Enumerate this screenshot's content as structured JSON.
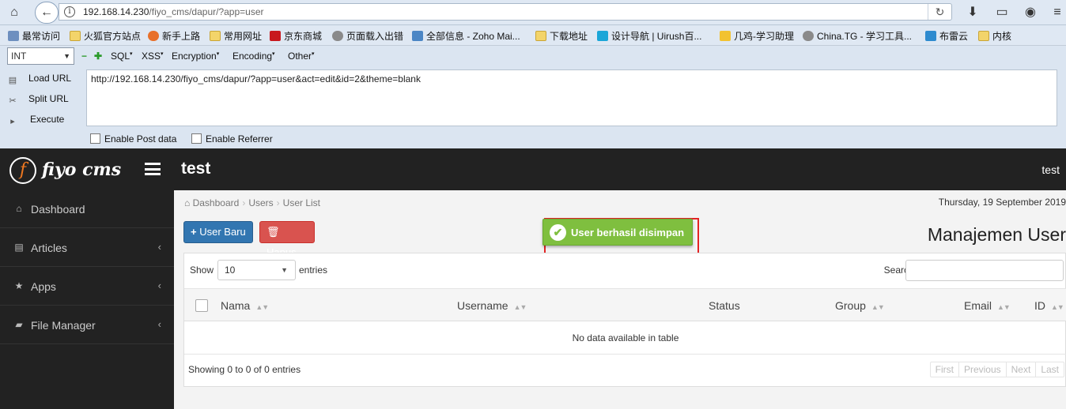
{
  "browser": {
    "url_host": "192.168.14.230",
    "url_path": "/fiyo_cms/dapur/?app=user",
    "bookmarks": [
      "最常访问",
      "火狐官方站点",
      "新手上路",
      "常用网址",
      "京东商城",
      "页面载入出错",
      "全部信息 - Zoho Mai...",
      "下载地址",
      "设计导航 | Uirush百...",
      "几鸡-学习助理",
      "China.TG - 学习工具...",
      "布雷云",
      "内核"
    ]
  },
  "hackbar": {
    "type_value": "INT",
    "menus": [
      "SQL",
      "XSS",
      "Encryption",
      "Encoding",
      "Other"
    ],
    "load_url": "Load URL",
    "split_url": "Split URL",
    "execute": "Execute",
    "url_text": "http://192.168.14.230/fiyo_cms/dapur/?app=user&act=edit&id=2&theme=blank",
    "enable_post": "Enable Post data",
    "enable_referrer": "Enable Referrer"
  },
  "header": {
    "brand": "fiyo cms",
    "logo_letter": "f",
    "site_title": "test",
    "user": "test"
  },
  "sidebar": {
    "items": [
      {
        "label": "Dashboard",
        "icon": "home-icon",
        "chevron": ""
      },
      {
        "label": "Articles",
        "icon": "file-icon",
        "chevron": "‹"
      },
      {
        "label": "Apps",
        "icon": "star-icon",
        "chevron": "‹"
      },
      {
        "label": "File Manager",
        "icon": "folder-open-icon",
        "chevron": "‹"
      }
    ]
  },
  "main": {
    "breadcrumb": [
      "Dashboard",
      "Users",
      "User List"
    ],
    "date": "Thursday, 19 September 2019",
    "new_user_label": "User Baru",
    "delete_label": "Hapus",
    "alert_message": "User berhasil disimpan",
    "page_title": "Manajemen User",
    "table": {
      "show_label": "Show",
      "page_length": "10",
      "entries_label": "entries",
      "search_label": "Search:",
      "columns": [
        "Nama",
        "Username",
        "Status",
        "Group",
        "Email",
        "ID"
      ],
      "empty_message": "No data available in table",
      "info": "Showing 0 to 0 of 0 entries",
      "pager": [
        "First",
        "Previous",
        "Next",
        "Last"
      ]
    }
  },
  "colors": {
    "header_bg": "#222222",
    "primary_button": "#3276b1",
    "danger_button": "#d9534f",
    "success_alert": "#7fbf3f",
    "highlight_frame": "#e32424"
  }
}
